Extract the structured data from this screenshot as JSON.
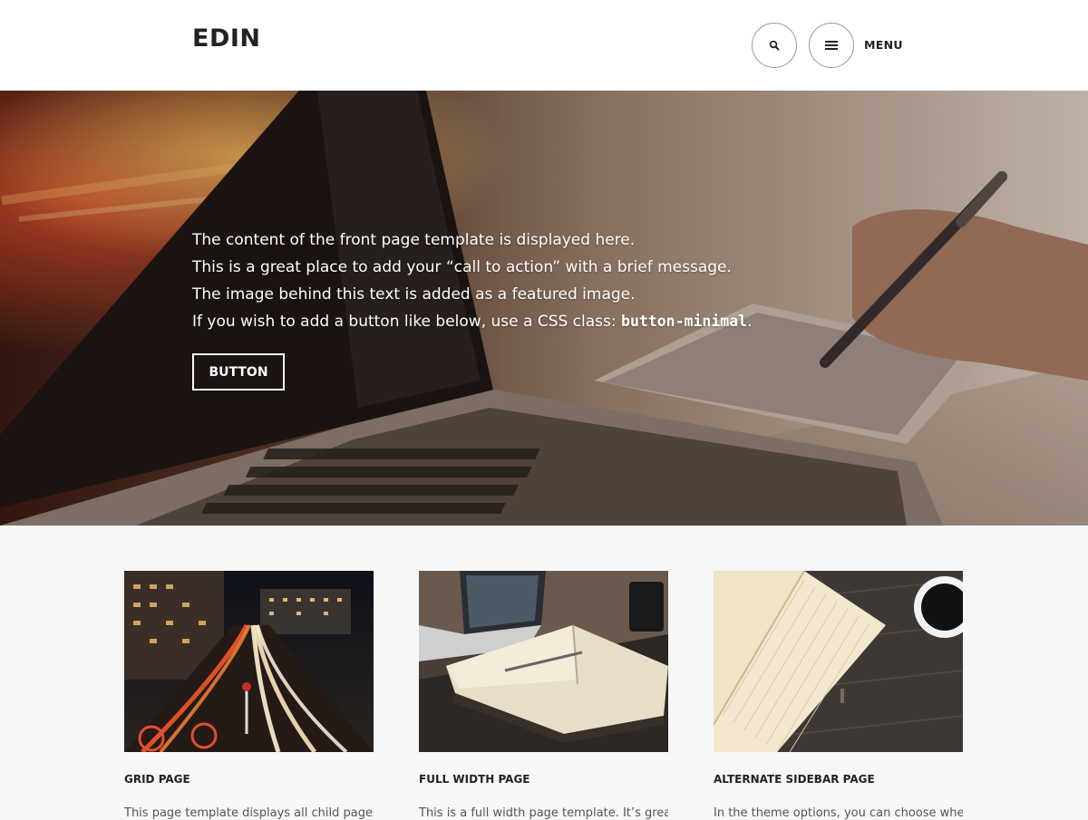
{
  "header": {
    "site_title": "EDIN",
    "menu_label": "MENU",
    "search_icon": "search-icon",
    "menu_icon": "hamburger-icon"
  },
  "hero": {
    "lines": [
      "The content of the front page template is displayed here.",
      "This is a great place to add your “call to action” with a brief message.",
      "The image behind this text is added as a featured image."
    ],
    "line4_prefix": "If you wish to add a button like below, use a CSS class: ",
    "line4_code": "button-minimal",
    "line4_suffix": ".",
    "button_label": "BUTTON"
  },
  "cards": [
    {
      "title": "GRID PAGE",
      "excerpt": "This page template displays all child pages in a"
    },
    {
      "title": "FULL WIDTH PAGE",
      "excerpt": "This is a full width page template. It’s great for"
    },
    {
      "title": "ALTERNATE SIDEBAR PAGE",
      "excerpt": "In the theme options, you can choose whether"
    }
  ]
}
